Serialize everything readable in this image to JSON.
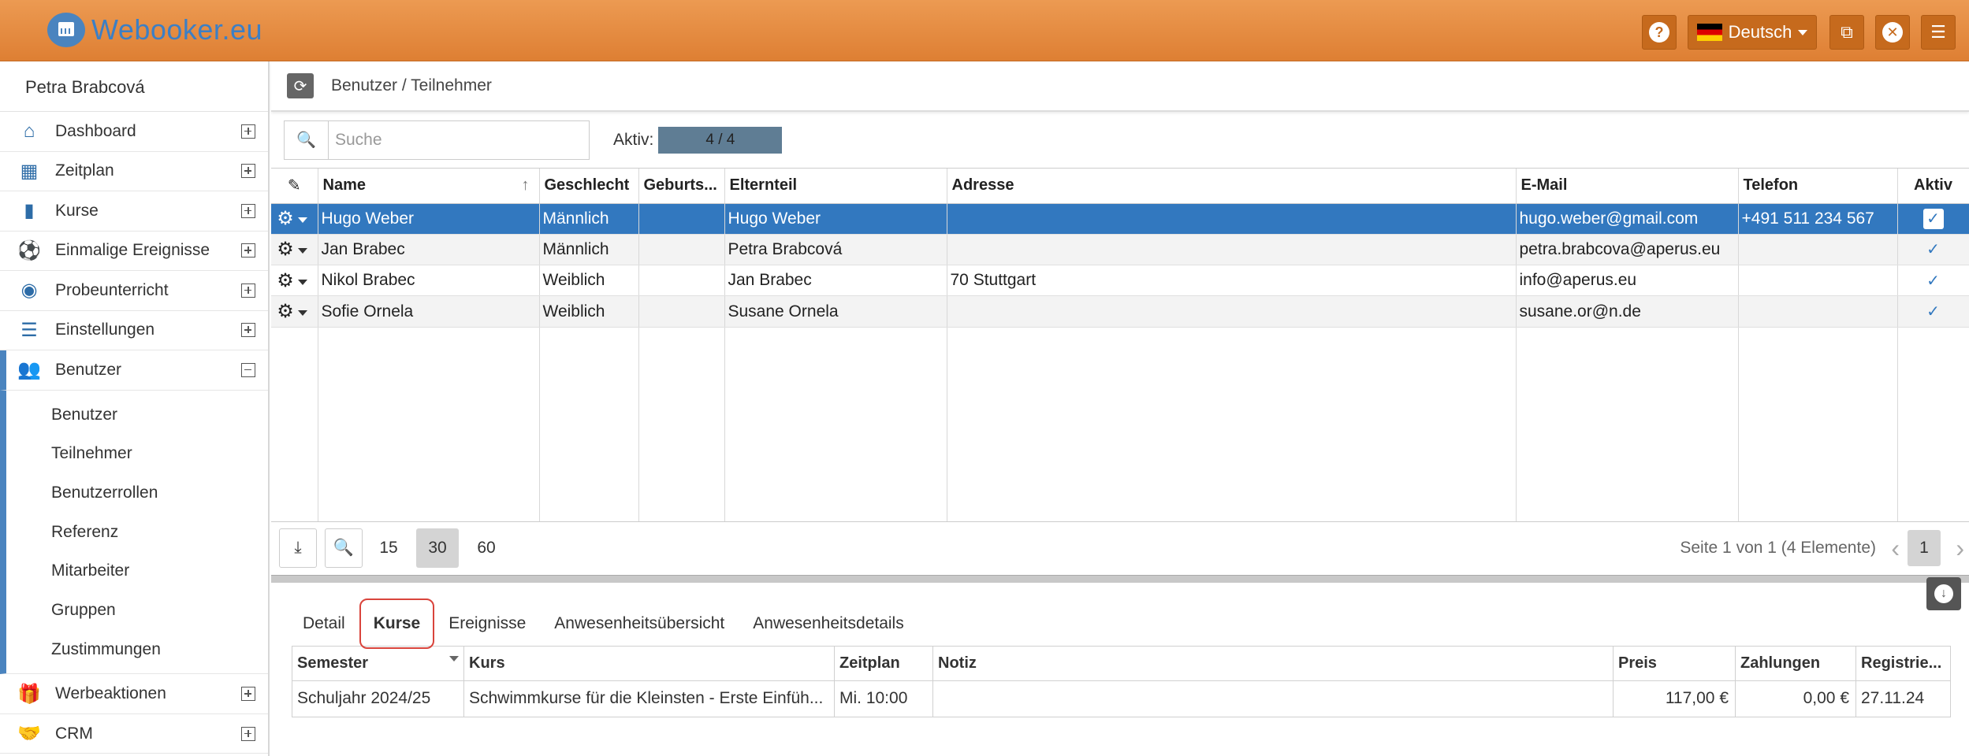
{
  "app": {
    "logo_text": "Webooker.eu"
  },
  "topbar": {
    "help_icon": "question-icon",
    "language": "Deutsch",
    "external_icon": "external-link-icon",
    "close_icon": "close-icon",
    "menu_icon": "menu-icon"
  },
  "sidebar": {
    "user": "Petra Brabcová",
    "items": [
      {
        "label": "Dashboard",
        "icon": "home-icon",
        "glyph": "⌂"
      },
      {
        "label": "Zeitplan",
        "icon": "calendar-icon",
        "glyph": "▦"
      },
      {
        "label": "Kurse",
        "icon": "book-icon",
        "glyph": "▮"
      },
      {
        "label": "Einmalige Ereignisse",
        "icon": "ball-icon",
        "glyph": "⚽"
      },
      {
        "label": "Probeunterricht",
        "icon": "eye-icon",
        "glyph": "◉"
      },
      {
        "label": "Einstellungen",
        "icon": "server-icon",
        "glyph": "☰"
      },
      {
        "label": "Benutzer",
        "icon": "users-icon",
        "glyph": "👥"
      }
    ],
    "subitems": [
      "Benutzer",
      "Teilnehmer",
      "Benutzerrollen",
      "Referenz",
      "Mitarbeiter",
      "Gruppen",
      "Zustimmungen"
    ],
    "bottom_items": [
      {
        "label": "Werbeaktionen",
        "icon": "gift-icon",
        "glyph": "🎁"
      },
      {
        "label": "CRM",
        "icon": "handshake-icon",
        "glyph": "🤝"
      }
    ]
  },
  "breadcrumb": "Benutzer / Teilnehmer",
  "toolbar": {
    "search_placeholder": "Suche",
    "aktiv_label": "Aktiv:",
    "aktiv_value": "4 / 4"
  },
  "grid": {
    "columns": [
      "Name",
      "Geschlecht",
      "Geburts...",
      "Elternteil",
      "Adresse",
      "E-Mail",
      "Telefon",
      "Aktiv"
    ],
    "rows": [
      {
        "name": "Hugo Weber",
        "gender": "Männlich",
        "birth": "",
        "parent": "Hugo Weber",
        "address": "",
        "email": "hugo.weber@gmail.com",
        "phone": "+491 511 234 567",
        "active": true
      },
      {
        "name": "Jan Brabec",
        "gender": "Männlich",
        "birth": "",
        "parent": "Petra Brabcová",
        "address": "",
        "email": "petra.brabcova@aperus.eu",
        "phone": "",
        "active": true
      },
      {
        "name": "Nikol Brabec",
        "gender": "Weiblich",
        "birth": "",
        "parent": "Jan Brabec",
        "address": "70 Stuttgart",
        "email": "info@aperus.eu",
        "phone": "",
        "active": true
      },
      {
        "name": "Sofie Ornela",
        "gender": "Weiblich",
        "birth": "",
        "parent": "Susane Ornela",
        "address": "",
        "email": "susane.or@n.de",
        "phone": "",
        "active": true
      }
    ]
  },
  "pager": {
    "sizes": [
      "15",
      "30",
      "60"
    ],
    "current_size": "30",
    "info": "Seite 1 von 1 (4 Elemente)",
    "page": "1"
  },
  "tabs": [
    "Detail",
    "Kurse",
    "Ereignisse",
    "Anwesenheitsübersicht",
    "Anwesenheitsdetails"
  ],
  "active_tab": "Kurse",
  "courses": {
    "columns": [
      "Semester",
      "Kurs",
      "Zeitplan",
      "Notiz",
      "Preis",
      "Zahlungen",
      "Registrie..."
    ],
    "rows": [
      {
        "semester": "Schuljahr 2024/25",
        "kurs": "Schwimmkurse für die Kleinsten - Erste Einfüh...",
        "zeitplan": "Mi. 10:00",
        "notiz": "",
        "preis": "117,00 €",
        "zahlungen": "0,00 €",
        "registriert": "27.11.24"
      }
    ]
  },
  "colors": {
    "topbar": "#e58b3f",
    "accent": "#3278bf",
    "badge": "#5f7d94"
  }
}
